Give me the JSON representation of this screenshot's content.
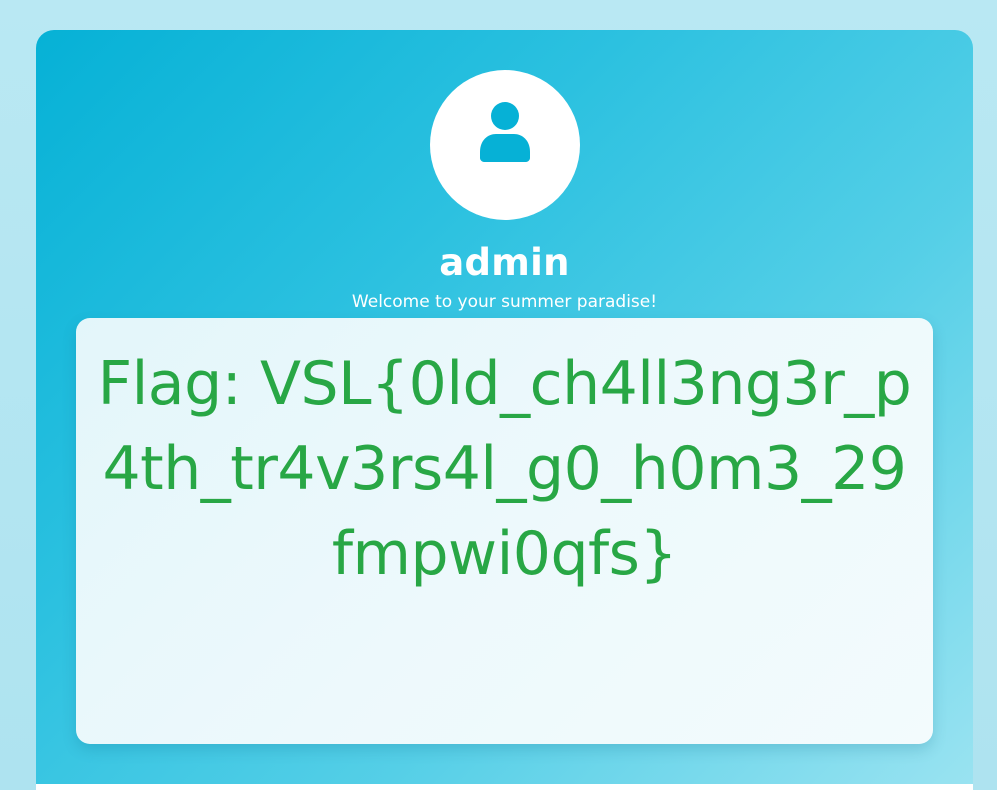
{
  "profile": {
    "username": "admin",
    "welcome_message": "Welcome to your summer paradise!",
    "avatar_icon": "user-icon"
  },
  "flag": {
    "label": "Flag:",
    "value": "VSL{0ld_ch4ll3ng3r_p4th_tr4v3rs4l_g0_h0m3_29fmpwi0qfs}"
  },
  "colors": {
    "accent": "#06b1d6",
    "flag_text": "#28a745",
    "background": "#b5e6f1"
  }
}
